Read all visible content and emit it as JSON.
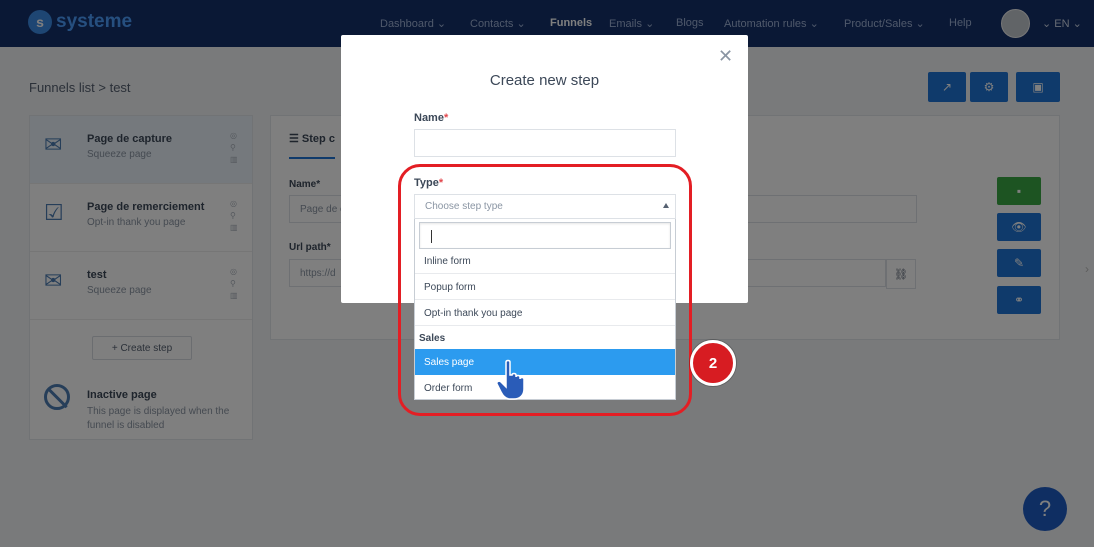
{
  "nav": {
    "logo": "systeme",
    "items": [
      {
        "label": "Dashboard",
        "caret": true,
        "active": false
      },
      {
        "label": "Contacts",
        "caret": true,
        "active": false
      },
      {
        "label": "Funnels",
        "caret": false,
        "active": true
      },
      {
        "label": "Emails",
        "caret": true,
        "active": false
      },
      {
        "label": "Blogs",
        "caret": false,
        "active": false
      },
      {
        "label": "Automation rules",
        "caret": true,
        "active": false
      },
      {
        "label": "Product/Sales",
        "caret": true,
        "active": false
      },
      {
        "label": "Help",
        "caret": false,
        "active": false
      }
    ],
    "lang": "EN"
  },
  "breadcrumb": {
    "root": "Funnels list",
    "current": "test"
  },
  "sidebar": {
    "steps": [
      {
        "title": "Page de capture",
        "subtitle": "Squeeze page",
        "icon": "envelope-icon"
      },
      {
        "title": "Page de remerciement",
        "subtitle": "Opt-in thank you page",
        "icon": "checkbox-icon"
      },
      {
        "title": "test",
        "subtitle": "Squeeze page",
        "icon": "envelope-icon"
      }
    ],
    "create_step": "+ Create step",
    "inactive": {
      "title": "Inactive page",
      "description": "This page is displayed when the funnel is disabled"
    }
  },
  "main": {
    "tab": "Step c",
    "name_label": "Name*",
    "name_value": "Page de c",
    "url_label": "Url path*",
    "url_value": "https://d"
  },
  "modal": {
    "title": "Create new step",
    "name_label": "Name",
    "type_label": "Type",
    "required_mark": "*",
    "type_placeholder": "Choose step type",
    "options": [
      {
        "label": "Inline form",
        "kind": "option",
        "highlighted": false
      },
      {
        "label": "Popup form",
        "kind": "option",
        "highlighted": false
      },
      {
        "label": "Opt-in thank you page",
        "kind": "option",
        "highlighted": false
      },
      {
        "label": "Sales",
        "kind": "group",
        "highlighted": false
      },
      {
        "label": "Sales page",
        "kind": "option",
        "highlighted": true
      },
      {
        "label": "Order form",
        "kind": "option",
        "highlighted": false
      }
    ]
  },
  "annotation": {
    "step_number": "2"
  },
  "help_label": "?",
  "colors": {
    "nav_bg": "#14306a",
    "accent": "#1f74d6",
    "highlight": "#2c9bef",
    "annotation_red": "#e31e24",
    "save_green": "#3aa845"
  }
}
